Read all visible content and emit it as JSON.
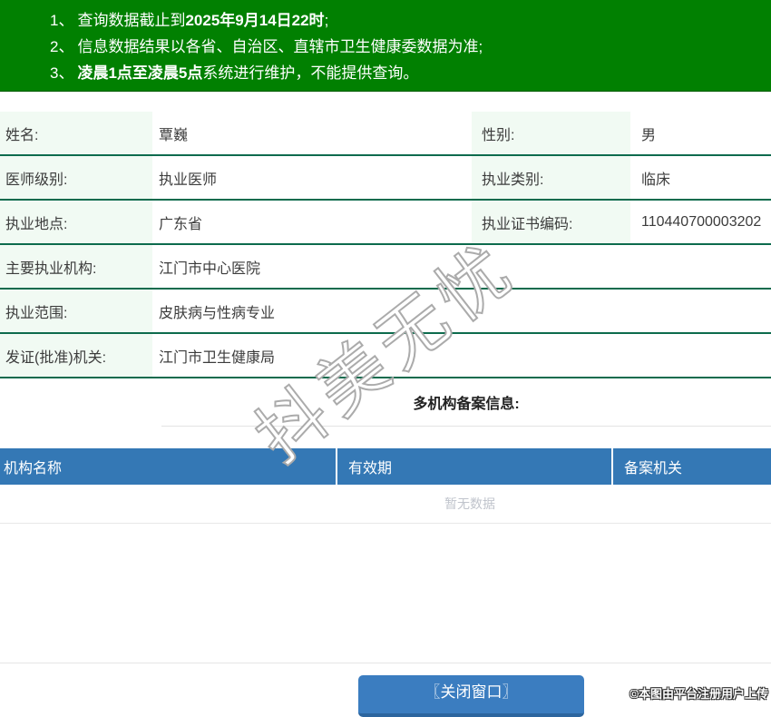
{
  "banner": {
    "bg_color": "#018001",
    "notices": [
      {
        "num": "1、",
        "pre": "查询数据截止到",
        "bold": "2025年9月14日22时",
        "post": ";"
      },
      {
        "num": "2、",
        "pre": "信息数据结果以各省、自治区、直辖市卫生健康委数据为准;",
        "bold": "",
        "post": ""
      },
      {
        "num": "3、",
        "pre": "",
        "bold": "凌晨1点至凌晨5点",
        "post": "系统进行维护，不能提供查询。"
      }
    ]
  },
  "info": {
    "rows": [
      {
        "label_a": "姓名:",
        "value_a": "覃巍",
        "label_b": "性别:",
        "value_b": "男"
      },
      {
        "label_a": "医师级别:",
        "value_a": "执业医师",
        "label_b": "执业类别:",
        "value_b": "临床"
      },
      {
        "label_a": "执业地点:",
        "value_a": "广东省",
        "label_b": "执业证书编码:",
        "value_b": "110440700003202"
      },
      {
        "label_a": "主要执业机构:",
        "value_a": "江门市中心医院"
      },
      {
        "label_a": "执业范围:",
        "value_a": "皮肤病与性病专业"
      },
      {
        "label_a": "发证(批准)机关:",
        "value_a": "江门市卫生健康局"
      }
    ],
    "label_bg": "#f1faf3",
    "divider_color": "#0d6b4d"
  },
  "section": {
    "title": "多机构备案信息:"
  },
  "record_table": {
    "header_bg": "#3478b5",
    "headers": [
      "机构名称",
      "有效期",
      "备案机关"
    ],
    "empty_text": "暂无数据"
  },
  "footer": {
    "close_button_label": "〖关闭窗口〗",
    "button_color": "#3b7dc0"
  },
  "watermarks": {
    "diagonal_text": "抖美无忧",
    "copyright_text": "©本图由平台注册用户上传"
  }
}
